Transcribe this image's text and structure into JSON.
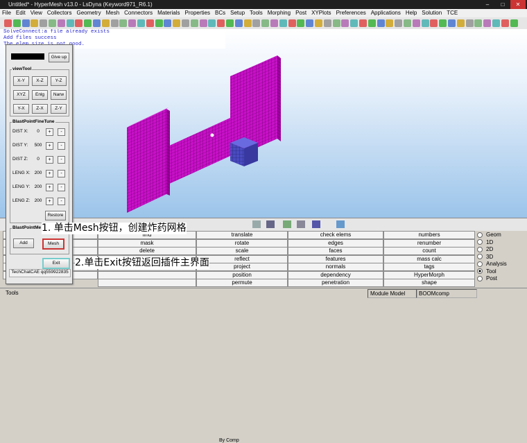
{
  "window": {
    "title": "Untitled* - HyperMesh v13.0 - LsDyna (Keyword971_R6.1)"
  },
  "menu": [
    "File",
    "Edit",
    "View",
    "Collectors",
    "Geometry",
    "Mesh",
    "Connectors",
    "Materials",
    "Properties",
    "BCs",
    "Setup",
    "Tools",
    "Morphing",
    "Post",
    "XYPlots",
    "Preferences",
    "Applications",
    "Help",
    "Solution",
    "TCE"
  ],
  "messages": [
    "SolveConnect:a file already exists",
    "Add files success",
    "The elem size is not good."
  ],
  "plugin": {
    "give_up": "Give up",
    "viewtool_title": "viewTool",
    "view_buttons": [
      "X-Y",
      "X-Z",
      "Y-Z",
      "XYZ",
      "Enlg",
      "Narw",
      "Y-X",
      "Z-X",
      "Z-Y"
    ],
    "finetune_title": "BlastPointFineTune",
    "params": [
      {
        "label": "DIST X:",
        "value": "0"
      },
      {
        "label": "DIST Y:",
        "value": "500"
      },
      {
        "label": "DIST Z:",
        "value": "0"
      },
      {
        "label": "LENG X:",
        "value": "200"
      },
      {
        "label": "LENG Y:",
        "value": "200"
      },
      {
        "label": "LENG Z:",
        "value": "200"
      }
    ],
    "plus": "+",
    "minus": "-",
    "restore": "Restore",
    "mesh_title": "BlastPointMe",
    "add": "Add",
    "mesh": "Mesh",
    "exit": "Exit",
    "watermark": "TechChatCAE qq559922835"
  },
  "annotations": [
    "1. 单击Mesh按钮，创建炸药网格",
    "2.单击Exit按钮返回插件主界面"
  ],
  "view_selector": "By Comp",
  "panel": {
    "col0": [
      "",
      "",
      "",
      "",
      "",
      "build menu"
    ],
    "col1": [
      "find",
      "mask",
      "delete",
      "",
      "",
      "",
      ""
    ],
    "col2": [
      "translate",
      "rotate",
      "scale",
      "reflect",
      "project",
      "position",
      "permute"
    ],
    "col3": [
      "check elems",
      "edges",
      "faces",
      "features",
      "normals",
      "dependency",
      "penetration"
    ],
    "col4": [
      "numbers",
      "renumber",
      "count",
      "mass calc",
      "tags",
      "HyperMorph",
      "shape"
    ]
  },
  "radios": [
    {
      "label": "Geom",
      "on": false
    },
    {
      "label": "1D",
      "on": false
    },
    {
      "label": "2D",
      "on": false
    },
    {
      "label": "3D",
      "on": false
    },
    {
      "label": "Analysis",
      "on": false
    },
    {
      "label": "Tool",
      "on": true
    },
    {
      "label": "Post",
      "on": false
    }
  ],
  "status": {
    "left": "Tools",
    "model": "Module Model",
    "comp": "BOOMcomp"
  }
}
